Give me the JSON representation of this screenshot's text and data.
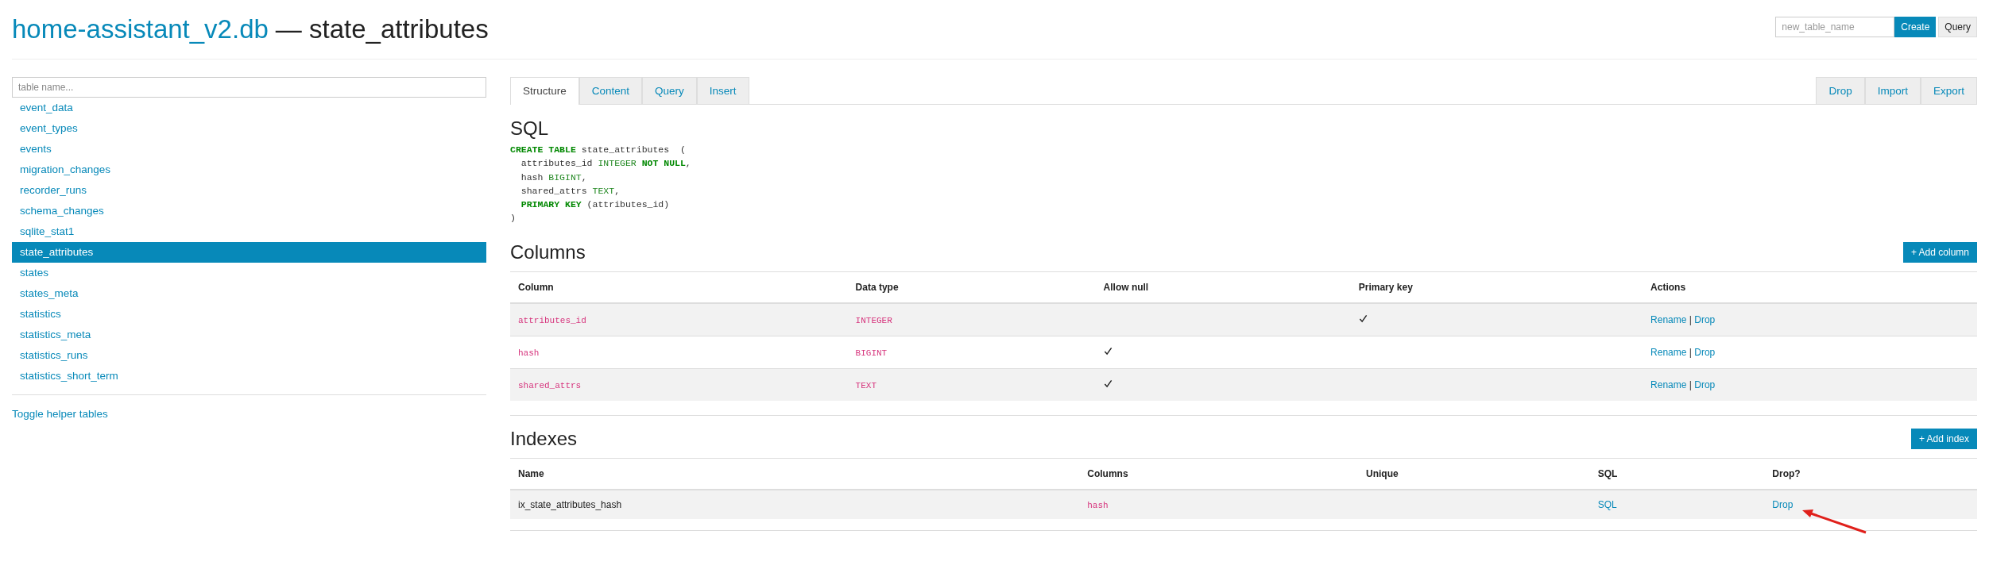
{
  "header": {
    "database": "home-assistant_v2.db",
    "table": "— state_attributes",
    "new_table_placeholder": "new_table_name",
    "create_button": "Create",
    "query_button": "Query"
  },
  "sidebar": {
    "search_placeholder": "table name...",
    "items": [
      {
        "label": "event_data",
        "selected": false
      },
      {
        "label": "event_types",
        "selected": false
      },
      {
        "label": "events",
        "selected": false
      },
      {
        "label": "migration_changes",
        "selected": false
      },
      {
        "label": "recorder_runs",
        "selected": false
      },
      {
        "label": "schema_changes",
        "selected": false
      },
      {
        "label": "sqlite_stat1",
        "selected": false
      },
      {
        "label": "state_attributes",
        "selected": true
      },
      {
        "label": "states",
        "selected": false
      },
      {
        "label": "states_meta",
        "selected": false
      },
      {
        "label": "statistics",
        "selected": false
      },
      {
        "label": "statistics_meta",
        "selected": false
      },
      {
        "label": "statistics_runs",
        "selected": false
      },
      {
        "label": "statistics_short_term",
        "selected": false
      }
    ],
    "toggle_link": "Toggle helper tables"
  },
  "tabs": [
    {
      "label": "Structure",
      "selected": true
    },
    {
      "label": "Content",
      "selected": false
    },
    {
      "label": "Query",
      "selected": false
    },
    {
      "label": "Insert",
      "selected": false
    }
  ],
  "actions": [
    "Drop",
    "Import",
    "Export"
  ],
  "sql": {
    "heading": "SQL",
    "lines": [
      [
        {
          "kind": "keyword",
          "text": "CREATE TABLE"
        },
        {
          "kind": "plain",
          "text": " state_attributes  ("
        }
      ],
      [
        {
          "kind": "plain",
          "text": "  attributes_id "
        },
        {
          "kind": "type",
          "text": "INTEGER"
        },
        {
          "kind": "keyword",
          "text": " NOT NULL"
        },
        {
          "kind": "plain",
          "text": ","
        }
      ],
      [
        {
          "kind": "plain",
          "text": "  hash "
        },
        {
          "kind": "type",
          "text": "BIGINT"
        },
        {
          "kind": "plain",
          "text": ","
        }
      ],
      [
        {
          "kind": "plain",
          "text": "  shared_attrs "
        },
        {
          "kind": "type",
          "text": "TEXT"
        },
        {
          "kind": "plain",
          "text": ","
        }
      ],
      [
        {
          "kind": "keyword",
          "text": "  PRIMARY KEY"
        },
        {
          "kind": "plain",
          "text": " (attributes_id)"
        }
      ],
      [
        {
          "kind": "plain",
          "text": ")"
        }
      ]
    ]
  },
  "columns_section": {
    "heading": "Columns",
    "add_button": "+ Add column",
    "columns": [
      "Column",
      "Data type",
      "Allow null",
      "Primary key",
      "Actions"
    ],
    "rows": [
      {
        "name": "attributes_id",
        "type": "INTEGER",
        "allow_null": false,
        "primary_key": true,
        "rename": "Rename",
        "separator": "|",
        "drop": "Drop"
      },
      {
        "name": "hash",
        "type": "BIGINT",
        "allow_null": true,
        "primary_key": false,
        "rename": "Rename",
        "separator": "|",
        "drop": "Drop"
      },
      {
        "name": "shared_attrs",
        "type": "TEXT",
        "allow_null": true,
        "primary_key": false,
        "rename": "Rename",
        "separator": "|",
        "drop": "Drop"
      }
    ]
  },
  "indexes_section": {
    "heading": "Indexes",
    "add_button": "+ Add index",
    "columns": [
      "Name",
      "Columns",
      "Unique",
      "SQL",
      "Drop?"
    ],
    "rows": [
      {
        "name": "ix_state_attributes_hash",
        "columns": "hash",
        "unique": false,
        "sql": "SQL",
        "drop": "Drop"
      }
    ]
  }
}
